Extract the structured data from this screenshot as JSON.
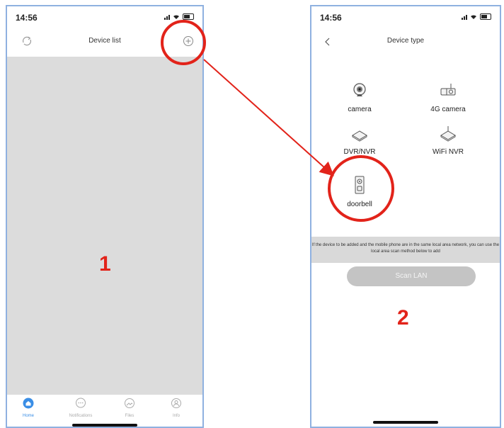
{
  "colors": {
    "accent": "#3a8ee6",
    "annotation": "#e2231a",
    "tab_inactive": "#aaaaaa",
    "info_bg": "#d9d9d9",
    "scan_bg": "#c4c4c4"
  },
  "screen1": {
    "time": "14:56",
    "title": "Device list",
    "left_icon": "refresh-icon",
    "right_icon": "add-circle-icon",
    "step_number": "1",
    "tabs": [
      {
        "label": "Home",
        "icon": "home-icon",
        "active": true
      },
      {
        "label": "Notifications",
        "icon": "chat-bubble-icon",
        "active": false
      },
      {
        "label": "Files",
        "icon": "image-icon",
        "active": false
      },
      {
        "label": "Info",
        "icon": "user-icon",
        "active": false
      }
    ]
  },
  "screen2": {
    "time": "14:56",
    "title": "Device type",
    "back_icon": "chevron-left-icon",
    "devices": [
      {
        "label": "camera",
        "icon": "webcam-icon"
      },
      {
        "label": "4G camera",
        "icon": "bullet-camera-icon"
      },
      {
        "label": "DVR/NVR",
        "icon": "dvr-box-icon"
      },
      {
        "label": "WiFi NVR",
        "icon": "wifi-nvr-icon"
      },
      {
        "label": "doorbell",
        "icon": "doorbell-icon"
      }
    ],
    "info_text": "If the device to be added and the mobile phone are in the same local area network, you can use the local area scan method below to add",
    "scan_button": "Scan LAN",
    "step_number": "2"
  }
}
